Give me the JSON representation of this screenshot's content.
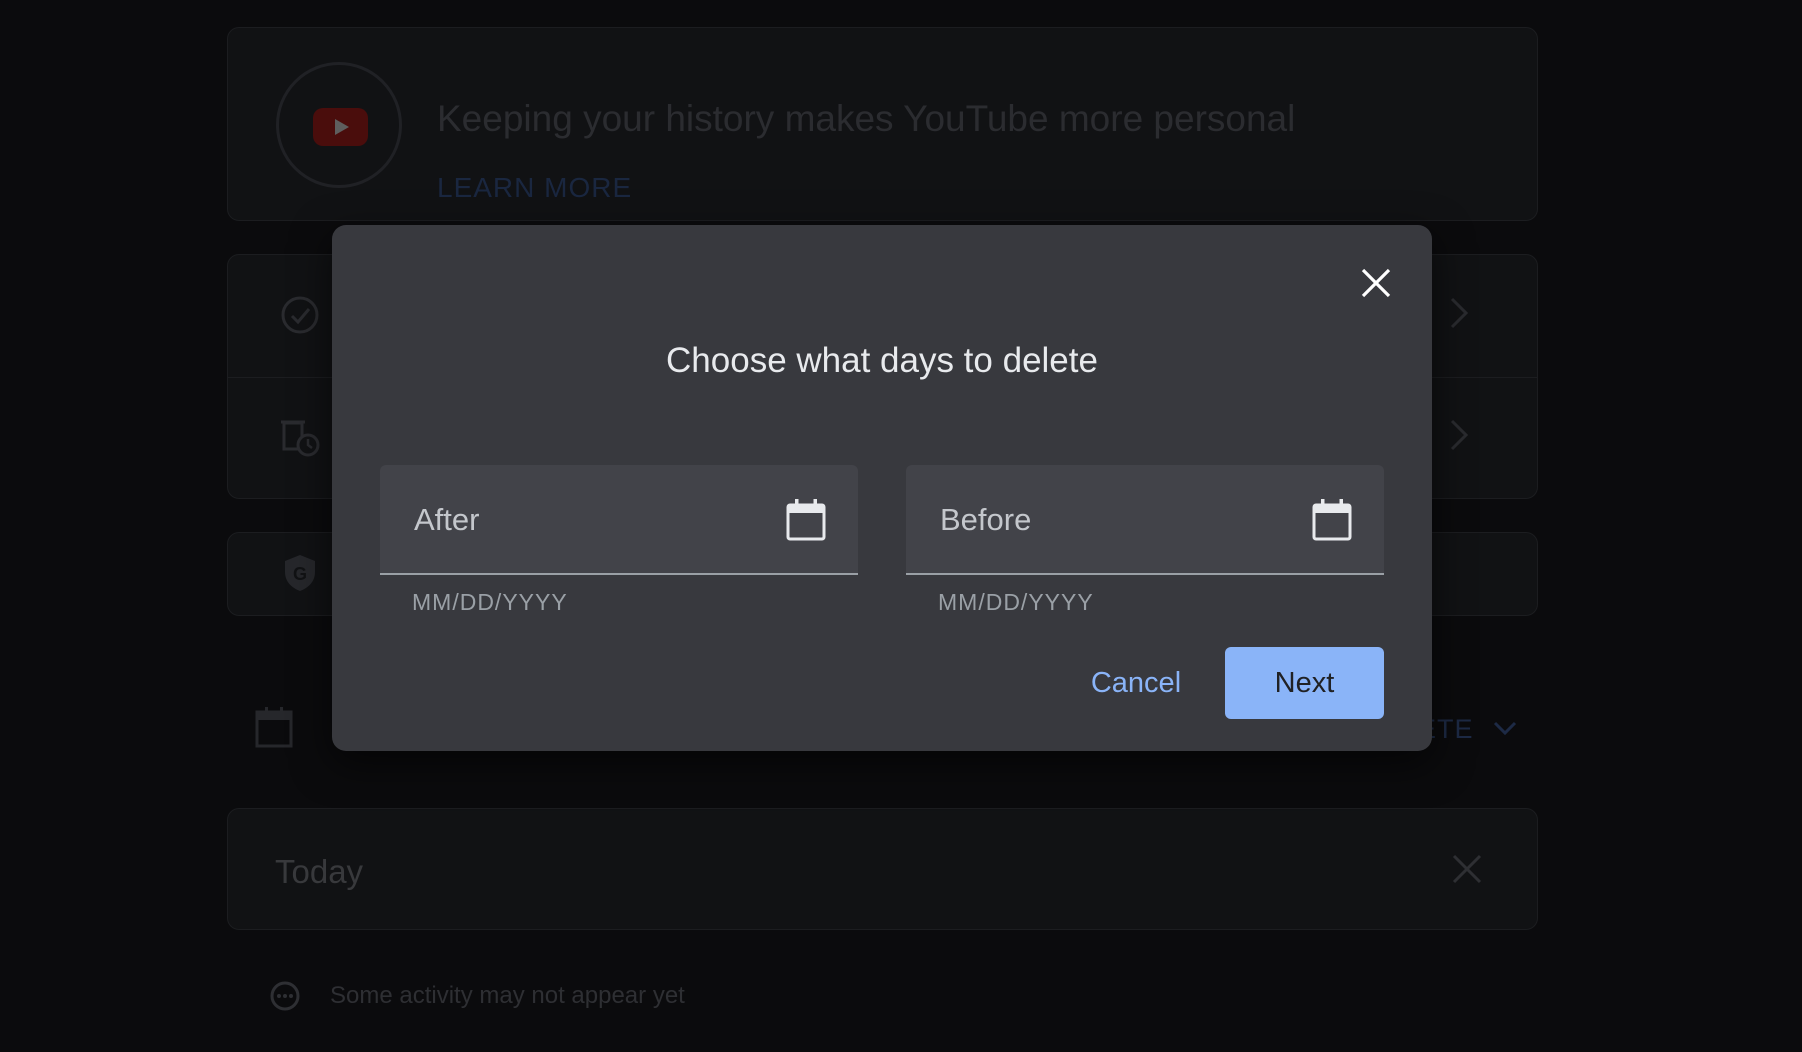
{
  "background": {
    "banner": {
      "title": "Keeping your history makes YouTube more personal",
      "link_label": "LEARN MORE"
    },
    "settings_rows": [
      {
        "icon": "check-circle-icon"
      },
      {
        "icon": "auto-delete-icon"
      }
    ],
    "protect_row": {
      "icon": "google-shield-icon"
    },
    "delete_menu": {
      "label": "ETE"
    },
    "today_section": {
      "label": "Today"
    },
    "note": {
      "text": "Some activity may not appear yet"
    }
  },
  "dialog": {
    "title": "Choose what days to delete",
    "after_field": {
      "label": "After",
      "value": "",
      "helper": "MM/DD/YYYY"
    },
    "before_field": {
      "label": "Before",
      "value": "",
      "helper": "MM/DD/YYYY"
    },
    "cancel_label": "Cancel",
    "next_label": "Next"
  },
  "colors": {
    "accent": "#8ab4f8",
    "dialog_bg": "#38393e",
    "field_bg": "#424349",
    "page_bg": "#0b0b0d"
  }
}
